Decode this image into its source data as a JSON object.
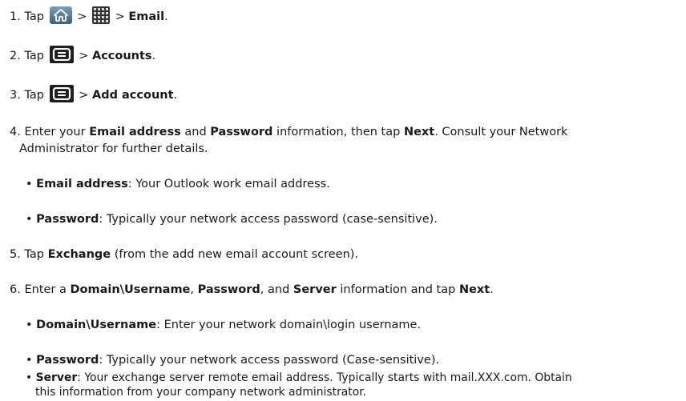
{
  "steps": {
    "s1": {
      "num": "1. Tap",
      "sep1": ">",
      "sep2": ">",
      "target": "Email",
      "end": "."
    },
    "s2": {
      "num": "2. Tap",
      "sep": ">",
      "target": "Accounts",
      "end": "."
    },
    "s3": {
      "num": "3. Tap",
      "sep": ">",
      "target": "Add account",
      "end": "."
    },
    "s4": {
      "t1": "4. Enter your ",
      "b1": "Email address",
      "t2": " and ",
      "b2": "Password",
      "t3": " information, then tap ",
      "b3": "Next",
      "t4": ". Consult your Network",
      "cont": "Administrator for further details."
    },
    "s4a": {
      "bullet": "• ",
      "label": "Email address",
      "text": ": Your Outlook work email address."
    },
    "s4b": {
      "bullet": "• ",
      "label": "Password",
      "text": ": Typically your network access password (case-sensitive)."
    },
    "s5": {
      "t1": "5. Tap ",
      "b1": "Exchange",
      "t2": " (from the add new email account screen)."
    },
    "s6": {
      "t1": "6. Enter a ",
      "b1": "Domain\\Username",
      "t2": ", ",
      "b2": "Password",
      "t3": ", and ",
      "b3": "Server",
      "t4": " information and tap ",
      "b4": "Next",
      "t5": "."
    },
    "s6a": {
      "bullet": "• ",
      "label": "Domain\\Username",
      "text": ": Enter your network domain\\login username."
    },
    "s6b": {
      "bullet": "• ",
      "label": "Password",
      "text": ": Typically your network access password (Case-sensitive)."
    },
    "s6c": {
      "bullet": "• ",
      "label": "Server",
      "text": ": Your exchange server remote email address. Typically starts with mail.XXX.com. Obtain",
      "cont": "this information from your company network administrator."
    }
  },
  "icons": {
    "home": "home-icon",
    "apps": "apps-grid-icon",
    "menu": "menu-key-icon"
  }
}
